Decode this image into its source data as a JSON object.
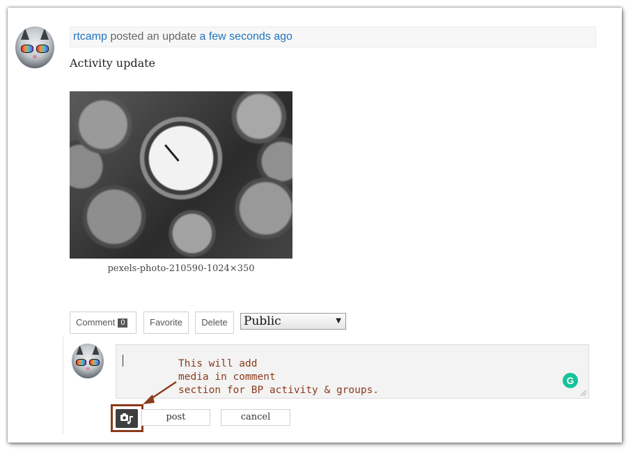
{
  "activity": {
    "author": "rtcamp",
    "action_text": "posted an update",
    "time_ago": "a few seconds ago",
    "title": "Activity update",
    "image_caption": "pexels-photo-210590-1024×350"
  },
  "actions": {
    "comment_label": "Comment",
    "comment_count": "0",
    "favorite_label": "Favorite",
    "delete_label": "Delete",
    "privacy_value": "Public"
  },
  "comment_form": {
    "post_label": "post",
    "cancel_label": "cancel",
    "grammarly_letter": "G"
  },
  "annotation": {
    "text": "This will add\nmedia in comment\nsection for BP activity & groups.",
    "color": "#8b3a1c"
  },
  "colors": {
    "link": "#1e73be",
    "grammarly": "#15c39a"
  }
}
